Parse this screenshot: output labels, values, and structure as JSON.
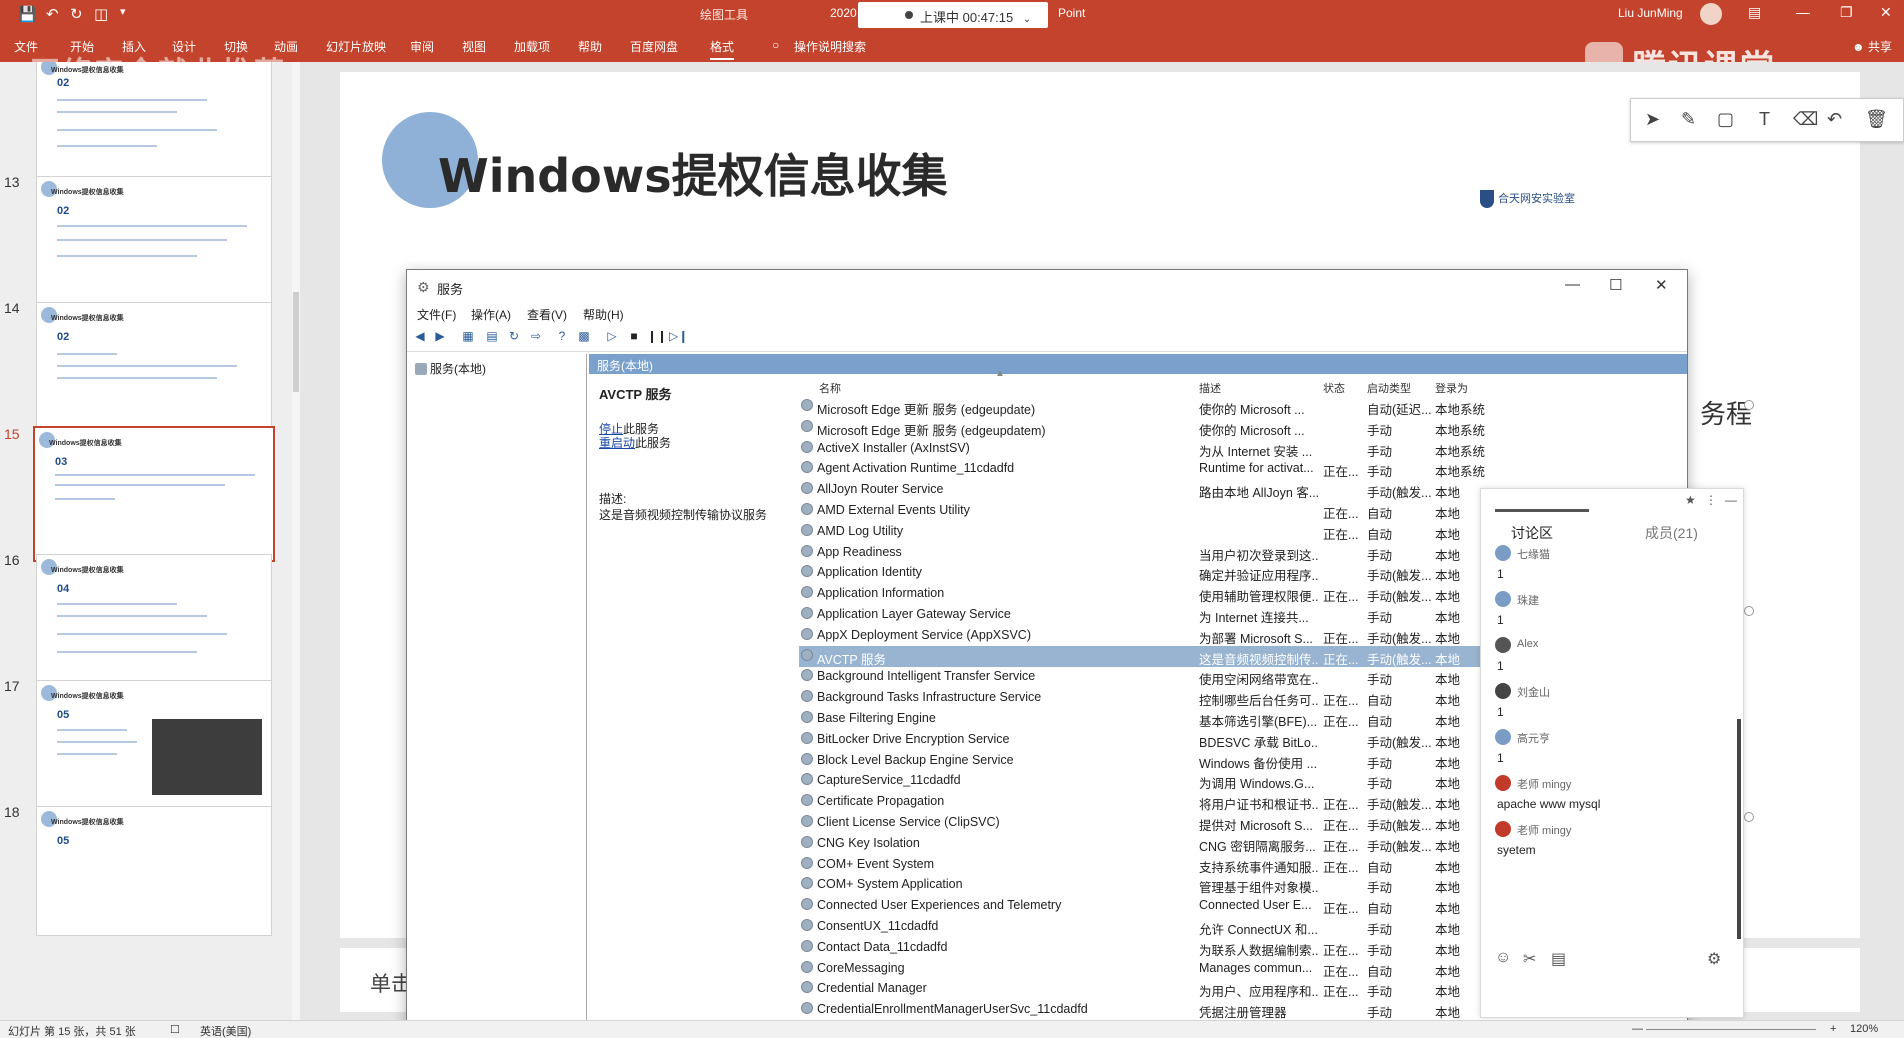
{
  "titlebar": {
    "context_tab": "绘图工具",
    "date_fragment": "2020",
    "class_status": "上课中 00:47:15",
    "app_fragment": "Point",
    "user": "Liu JunMing"
  },
  "ribbon": {
    "tabs": [
      "文件",
      "开始",
      "插入",
      "设计",
      "切换",
      "动画",
      "幻灯片放映",
      "审阅",
      "视图",
      "加载项",
      "帮助",
      "百度网盘",
      "格式",
      "操作说明搜索"
    ],
    "share": "共享"
  },
  "watermark": {
    "left": "网络安全就业推荐",
    "right": "腾讯课堂"
  },
  "thumbnails": {
    "items": [
      {
        "num": "",
        "title": "Windows提权信息收集",
        "section": "02"
      },
      {
        "num": "13",
        "title": "Windows提权信息收集",
        "section": "02"
      },
      {
        "num": "14",
        "title": "Windows提权信息收集",
        "section": "02"
      },
      {
        "num": "15",
        "title": "Windows提权信息收集",
        "section": "03"
      },
      {
        "num": "16",
        "title": "Windows提权信息收集",
        "section": "04"
      },
      {
        "num": "17",
        "title": "Windows提权信息收集",
        "section": "05"
      },
      {
        "num": "18",
        "title": "Windows提权信息收集",
        "section": "05"
      }
    ]
  },
  "slide": {
    "title": "Windows提权信息收集",
    "right_fragment": "务程",
    "badge": "合天网安实验室",
    "notes_placeholder": "单击此处"
  },
  "services": {
    "window_title": "服务",
    "menu": [
      "文件(F)",
      "操作(A)",
      "查看(V)",
      "帮助(H)"
    ],
    "tree_node": "服务(本地)",
    "header": "服务(本地)",
    "detail": {
      "name": "AVCTP 服务",
      "stop_link": "停止",
      "stop_suffix": "此服务",
      "restart_link": "重启动",
      "restart_suffix": "此服务",
      "desc_label": "描述:",
      "desc": "这是音频视频控制传输协议服务"
    },
    "columns": [
      "名称",
      "描述",
      "状态",
      "启动类型",
      "登录为"
    ],
    "rows": [
      {
        "name": "Microsoft Edge 更新 服务 (edgeupdate)",
        "desc": "使你的 Microsoft ...",
        "status": "",
        "startup": "自动(延迟...",
        "logon": "本地系统"
      },
      {
        "name": "Microsoft Edge 更新 服务 (edgeupdatem)",
        "desc": "使你的 Microsoft ...",
        "status": "",
        "startup": "手动",
        "logon": "本地系统"
      },
      {
        "name": "ActiveX Installer (AxInstSV)",
        "desc": "为从 Internet 安装 ...",
        "status": "",
        "startup": "手动",
        "logon": "本地系统"
      },
      {
        "name": "Agent Activation Runtime_11cdadfd",
        "desc": "Runtime for activat...",
        "status": "正在...",
        "startup": "手动",
        "logon": "本地系统"
      },
      {
        "name": "AllJoyn Router Service",
        "desc": "路由本地 AllJoyn 客...",
        "status": "",
        "startup": "手动(触发...",
        "logon": "本地"
      },
      {
        "name": "AMD External Events Utility",
        "desc": "",
        "status": "正在...",
        "startup": "自动",
        "logon": "本地"
      },
      {
        "name": "AMD Log Utility",
        "desc": "",
        "status": "正在...",
        "startup": "自动",
        "logon": "本地"
      },
      {
        "name": "App Readiness",
        "desc": "当用户初次登录到这...",
        "status": "",
        "startup": "手动",
        "logon": "本地"
      },
      {
        "name": "Application Identity",
        "desc": "确定并验证应用程序...",
        "status": "",
        "startup": "手动(触发...",
        "logon": "本地"
      },
      {
        "name": "Application Information",
        "desc": "使用辅助管理权限便...",
        "status": "正在...",
        "startup": "手动(触发...",
        "logon": "本地"
      },
      {
        "name": "Application Layer Gateway Service",
        "desc": "为 Internet 连接共...",
        "status": "",
        "startup": "手动",
        "logon": "本地"
      },
      {
        "name": "AppX Deployment Service (AppXSVC)",
        "desc": "为部署 Microsoft S...",
        "status": "正在...",
        "startup": "手动(触发...",
        "logon": "本地"
      },
      {
        "name": "AVCTP 服务",
        "desc": "这是音频视频控制传...",
        "status": "正在...",
        "startup": "手动(触发...",
        "logon": "本地"
      },
      {
        "name": "Background Intelligent Transfer Service",
        "desc": "使用空闲网络带宽在...",
        "status": "",
        "startup": "手动",
        "logon": "本地"
      },
      {
        "name": "Background Tasks Infrastructure Service",
        "desc": "控制哪些后台任务可...",
        "status": "正在...",
        "startup": "自动",
        "logon": "本地"
      },
      {
        "name": "Base Filtering Engine",
        "desc": "基本筛选引擎(BFE)...",
        "status": "正在...",
        "startup": "自动",
        "logon": "本地"
      },
      {
        "name": "BitLocker Drive Encryption Service",
        "desc": "BDESVC 承载 BitLo...",
        "status": "",
        "startup": "手动(触发...",
        "logon": "本地"
      },
      {
        "name": "Block Level Backup Engine Service",
        "desc": "Windows 备份使用 ...",
        "status": "",
        "startup": "手动",
        "logon": "本地"
      },
      {
        "name": "CaptureService_11cdadfd",
        "desc": "为调用 Windows.G...",
        "status": "",
        "startup": "手动",
        "logon": "本地"
      },
      {
        "name": "Certificate Propagation",
        "desc": "将用户证书和根证书...",
        "status": "正在...",
        "startup": "手动(触发...",
        "logon": "本地"
      },
      {
        "name": "Client License Service (ClipSVC)",
        "desc": "提供对 Microsoft S...",
        "status": "正在...",
        "startup": "手动(触发...",
        "logon": "本地"
      },
      {
        "name": "CNG Key Isolation",
        "desc": "CNG 密钥隔离服务...",
        "status": "正在...",
        "startup": "手动(触发...",
        "logon": "本地"
      },
      {
        "name": "COM+ Event System",
        "desc": "支持系统事件通知服...",
        "status": "正在...",
        "startup": "自动",
        "logon": "本地"
      },
      {
        "name": "COM+ System Application",
        "desc": "管理基于组件对象模...",
        "status": "",
        "startup": "手动",
        "logon": "本地"
      },
      {
        "name": "Connected User Experiences and Telemetry",
        "desc": "Connected User E...",
        "status": "正在...",
        "startup": "自动",
        "logon": "本地"
      },
      {
        "name": "ConsentUX_11cdadfd",
        "desc": "允许 ConnectUX 和...",
        "status": "",
        "startup": "手动",
        "logon": "本地"
      },
      {
        "name": "Contact Data_11cdadfd",
        "desc": "为联系人数据编制索...",
        "status": "正在...",
        "startup": "手动",
        "logon": "本地"
      },
      {
        "name": "CoreMessaging",
        "desc": "Manages commun...",
        "status": "正在...",
        "startup": "自动",
        "logon": "本地"
      },
      {
        "name": "Credential Manager",
        "desc": "为用户、应用程序和...",
        "status": "正在...",
        "startup": "手动",
        "logon": "本地"
      },
      {
        "name": "CredentialEnrollmentManagerUserSvc_11cdadfd",
        "desc": "凭据注册管理器",
        "status": "",
        "startup": "手动",
        "logon": "本地"
      }
    ]
  },
  "chat": {
    "tab_discussion": "讨论区",
    "tab_members": "成员(21)",
    "messages": [
      {
        "name": "七缘猫",
        "text": "1",
        "color": "#7a9cc5"
      },
      {
        "name": "珠建",
        "text": "1",
        "color": "#7a9cc5"
      },
      {
        "name": "Alex",
        "text": "1",
        "color": "#555555"
      },
      {
        "name": "刘金山",
        "text": "1",
        "color": "#444444"
      },
      {
        "name": "高元亨",
        "text": "1",
        "color": "#7a9cc5"
      },
      {
        "name": "老师 mingy",
        "text": "apache www mysql",
        "color": "#c23a2a"
      },
      {
        "name": "老师 mingy",
        "text": "syetem",
        "color": "#c23a2a"
      }
    ]
  },
  "status": {
    "slide_info": "幻灯片 第 15 张，共 51 张",
    "language": "英语(美国)",
    "zoom": "120%"
  },
  "colors": {
    "accent": "#c4432c",
    "selection": "#99b4d1",
    "panel_head": "#7aa0cc"
  }
}
